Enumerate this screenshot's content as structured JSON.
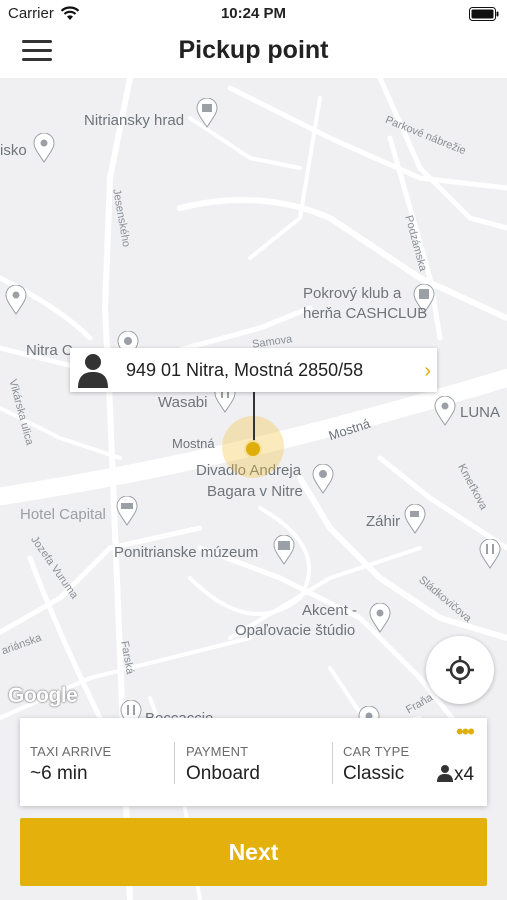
{
  "status_bar": {
    "carrier": "Carrier",
    "time": "10:24 PM"
  },
  "nav": {
    "title": "Pickup point"
  },
  "map": {
    "labels": {
      "nitriansky_hrad": "Nitriansky hrad",
      "isko": "isko",
      "parkove_nabrezie": "Parkové nábrežie",
      "jesenskeho": "Jesenského",
      "podzamska": "Podzámska",
      "pokrovy_klub": "Pokrový klub a",
      "herna": "herňa CASHCLUB",
      "samova": "Samova",
      "nitra_c": "Nitra C",
      "wasabi": "Wasabi",
      "luna": "LUNA",
      "vikarska": "Vikárska ulica",
      "mostna_left": "Mostná",
      "mostna_right": "Mostná",
      "divadlo1": "Divadlo Andreja",
      "divadlo2": "Bagara v Nitre",
      "kmetkova": "Kmeťkova",
      "hotel_capital": "Hotel Capital",
      "zahir": "Záhir",
      "jozefa_vuruma": "Jozefa Vuruma",
      "ponitrianske": "Ponitrianske múzeum",
      "sladkovicova": "Sládkovičova",
      "akcent1": "Akcent -",
      "akcent2": "Opaľovacie štúdio",
      "farska": "Farská",
      "arianska": "ariánska",
      "fraha": "Fraňa",
      "boccaccio": "Boccaccio"
    },
    "address": "949 01 Nitra, Mostná 2850/58"
  },
  "info": {
    "taxi_label": "TAXI ARRIVE",
    "taxi_value": "~6 min",
    "payment_label": "PAYMENT",
    "payment_value": "Onboard",
    "car_label": "CAR TYPE",
    "car_value": "Classic",
    "seats": "x4",
    "more": "•••"
  },
  "next_button": "Next",
  "colors": {
    "accent": "#e3b00c",
    "map_bg": "#f0f0f3",
    "road": "#ffffff"
  }
}
